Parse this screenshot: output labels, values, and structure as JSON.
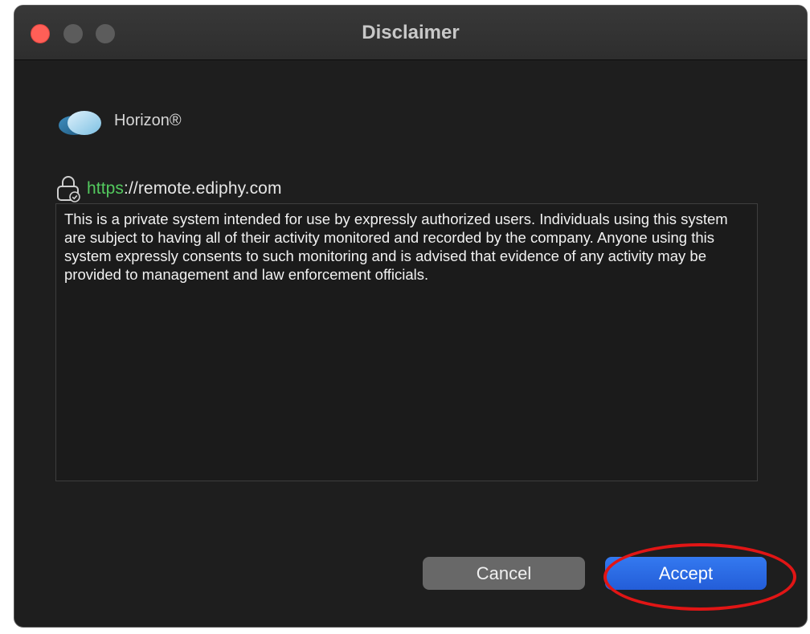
{
  "window": {
    "title": "Disclaimer"
  },
  "brand": {
    "name": "Horizon®",
    "logo_icon": "cloud-icon"
  },
  "server": {
    "icon": "lock-check-icon",
    "scheme": "https",
    "rest": "://remote.ediphy.com",
    "scheme_color": "#53c95e"
  },
  "disclaimer": {
    "text": "This is a private system intended for use by expressly authorized users. Individuals using this system are subject to having all of their activity monitored and recorded by the company. Anyone using this system expressly consents to such monitoring and is advised that evidence of any activity may be provided to management and law enforcement officials."
  },
  "buttons": {
    "cancel_label": "Cancel",
    "accept_label": "Accept"
  },
  "colors": {
    "accent": "#2f6fe6",
    "annotation": "#e11515",
    "close": "#ff5f57"
  }
}
